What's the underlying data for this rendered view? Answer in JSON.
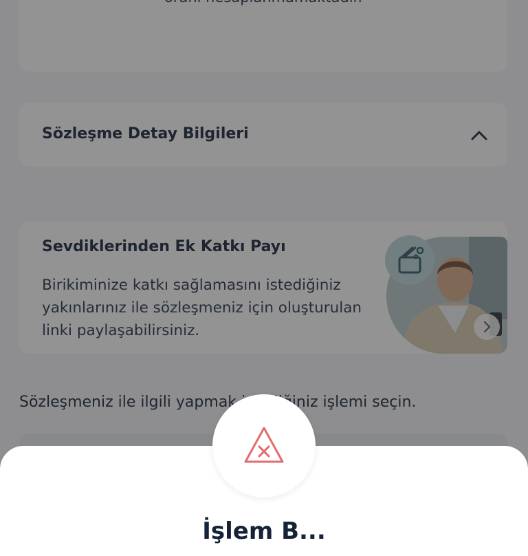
{
  "top_card": {
    "partial_text": "oranı hesaplanmamaktadır."
  },
  "contract_details": {
    "title": "Sözleşme Detay Bilgileri",
    "toggle_icon": "chevron-up-icon"
  },
  "promo": {
    "title": "Sevdiklerinden Ek Katkı Payı",
    "description": "Birikiminize katkı sağlamasını istediğiniz yakınlarınız ile sözleşmeniz için oluşturulan linki paylaşabilirsiniz.",
    "badge_icon": "gift-card-icon",
    "arrow_icon": "chevron-right-icon",
    "image_icon": "man-with-phone-photo"
  },
  "instruction": "Sözleşmeniz ile ilgili yapmak istediğiniz işlemi seçin.",
  "modal": {
    "icon": "warning-triangle-x-icon",
    "title": "İşlem B..."
  },
  "colors": {
    "background": "#f4f5f8",
    "card": "#ffffff",
    "text": "#152238",
    "warning": "#e26b6b",
    "overlay": "rgba(40,40,40,0.5)"
  }
}
